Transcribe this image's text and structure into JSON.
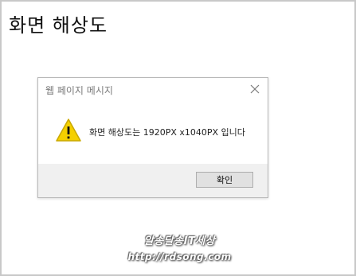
{
  "page": {
    "title": "화면 해상도"
  },
  "dialog": {
    "title": "웹 페이지 메시지",
    "message": "화면 해상도는 1920PX x1040PX 입니다",
    "ok_label": "확인",
    "icons": {
      "close": "close-icon",
      "warning": "warning-icon"
    }
  },
  "watermark": {
    "line1": "알송달송IT세상",
    "line2": "http://rdsong.com"
  },
  "colors": {
    "warning_yellow": "#f5d000",
    "footer_bg": "#f0f0f0",
    "button_bg": "#e1e1e1"
  }
}
